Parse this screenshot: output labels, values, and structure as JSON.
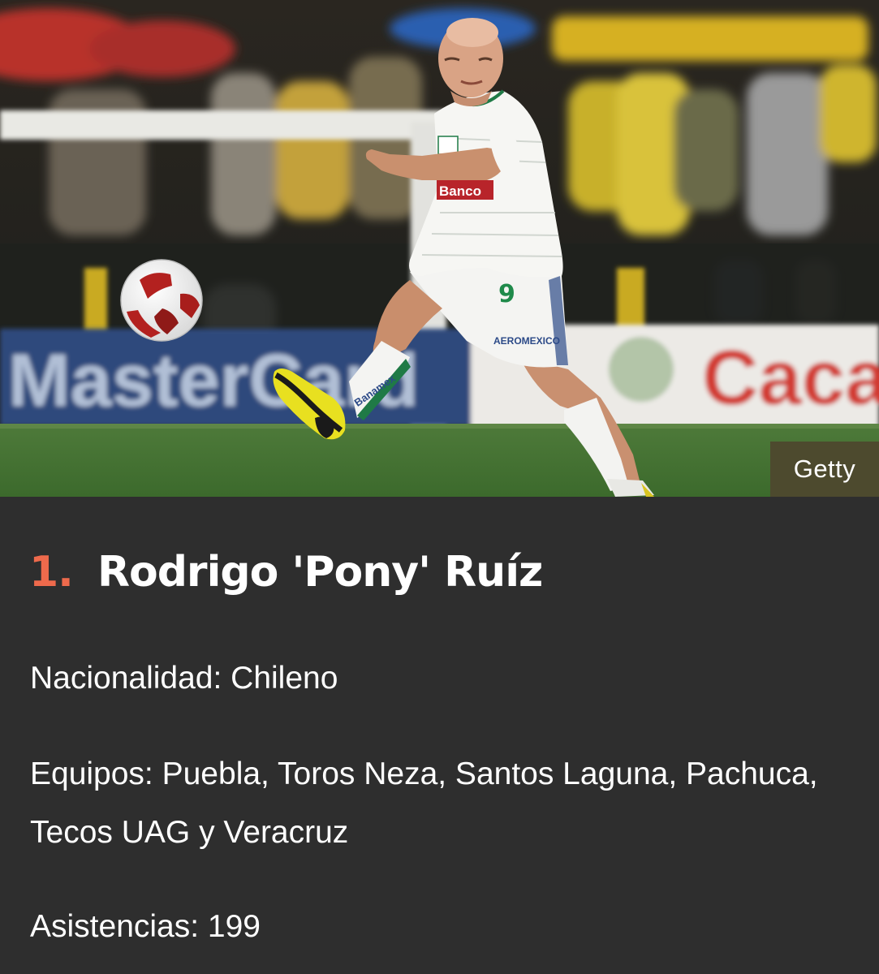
{
  "photo": {
    "credit": "Getty",
    "jersey_number": "9"
  },
  "entry": {
    "rank": "1.",
    "name": "Rodrigo 'Pony' Ruíz"
  },
  "details": {
    "nationality": "Nacionalidad: Chileno",
    "teams": "Equipos: Puebla, Toros Neza, Santos Laguna, Pachuca, Tecos UAG y Veracruz",
    "assists": "Asistencias: 199"
  },
  "colors": {
    "background": "#2e2e2e",
    "accent_rank": "#ee6a4c",
    "text": "#ffffff",
    "credit_badge": "#4d4a2e"
  }
}
